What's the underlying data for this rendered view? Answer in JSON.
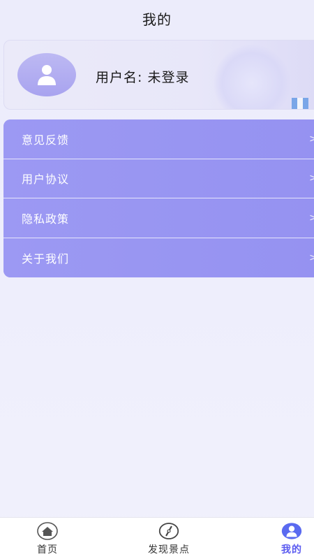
{
  "header": {
    "title": "我的"
  },
  "profile": {
    "username_text": "用户名: 未登录"
  },
  "menu": {
    "items": [
      {
        "label": "意见反馈",
        "name": "feedback"
      },
      {
        "label": "用户协议",
        "name": "user-agreement"
      },
      {
        "label": "隐私政策",
        "name": "privacy-policy"
      },
      {
        "label": "关于我们",
        "name": "about-us"
      }
    ],
    "chevron": ">"
  },
  "nav": {
    "items": [
      {
        "label": "首页",
        "icon": "home-icon"
      },
      {
        "label": "发现景点",
        "icon": "compass-icon"
      },
      {
        "label": "我的",
        "icon": "user-icon",
        "active": true
      }
    ]
  },
  "colors": {
    "accent": "#9794f2",
    "active_nav": "#5a5af0",
    "background": "#ececfb"
  }
}
